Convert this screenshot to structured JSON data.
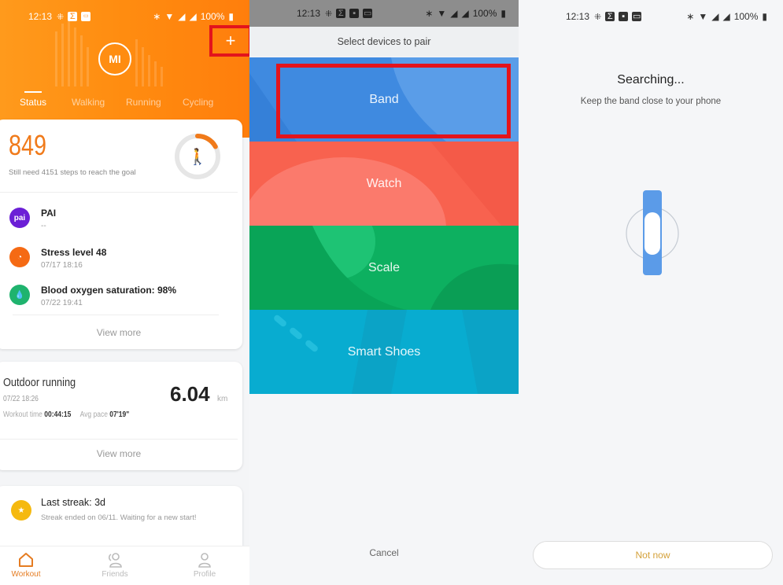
{
  "status_bar": {
    "time": "12:13",
    "battery": "100%"
  },
  "panel1": {
    "tabs": [
      {
        "label": "Status"
      },
      {
        "label": "Walking"
      },
      {
        "label": "Running"
      },
      {
        "label": "Cycling"
      }
    ],
    "add_icon": "+",
    "logo_text": "MI",
    "steps": {
      "value": "849",
      "subtitle": "Still need 4151 steps to reach the goal",
      "progress_fraction": 0.17
    },
    "metrics": [
      {
        "icon": "pai",
        "title": "PAI",
        "sub": "--",
        "color": "#6b1fd6"
      },
      {
        "icon": "stress",
        "title": "Stress level 48",
        "sub": "07/17 18:16",
        "color": "#f56a14"
      },
      {
        "icon": "blood-oxygen",
        "title": "Blood oxygen saturation: 98%",
        "sub": "07/22 19:41",
        "color": "#1fb36e"
      }
    ],
    "view_more": "View more",
    "workout": {
      "title": "Outdoor running",
      "date": "07/22 18:26",
      "time_label": "Workout time",
      "time_value": "00:44:15",
      "pace_label": "Avg pace",
      "pace_value": "07'19\"",
      "distance": "6.04",
      "unit": "km"
    },
    "streak": {
      "title": "Last streak: 3d",
      "sub": "Streak ended on 06/11. Waiting for a new start!"
    },
    "nav": [
      {
        "label": "Workout"
      },
      {
        "label": "Friends"
      },
      {
        "label": "Profile"
      }
    ]
  },
  "panel2": {
    "title": "Select devices to pair",
    "devices": [
      {
        "label": "Band",
        "color": "#3f8ae0"
      },
      {
        "label": "Watch",
        "color": "#f8624f"
      },
      {
        "label": "Scale",
        "color": "#0db060"
      },
      {
        "label": "Smart Shoes",
        "color": "#08acd0"
      }
    ],
    "cancel": "Cancel"
  },
  "panel3": {
    "title": "Searching...",
    "subtitle": "Keep the band close to your phone",
    "button": "Not now"
  }
}
